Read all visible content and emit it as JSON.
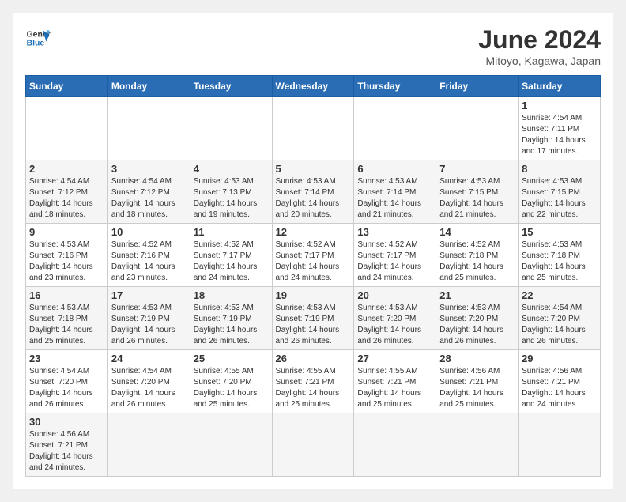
{
  "header": {
    "logo_general": "General",
    "logo_blue": "Blue",
    "month_title": "June 2024",
    "location": "Mitoyo, Kagawa, Japan"
  },
  "days_of_week": [
    "Sunday",
    "Monday",
    "Tuesday",
    "Wednesday",
    "Thursday",
    "Friday",
    "Saturday"
  ],
  "weeks": [
    [
      {
        "day": "",
        "info": ""
      },
      {
        "day": "",
        "info": ""
      },
      {
        "day": "",
        "info": ""
      },
      {
        "day": "",
        "info": ""
      },
      {
        "day": "",
        "info": ""
      },
      {
        "day": "",
        "info": ""
      },
      {
        "day": "1",
        "info": "Sunrise: 4:54 AM\nSunset: 7:11 PM\nDaylight: 14 hours\nand 17 minutes."
      }
    ],
    [
      {
        "day": "2",
        "info": "Sunrise: 4:54 AM\nSunset: 7:12 PM\nDaylight: 14 hours\nand 18 minutes."
      },
      {
        "day": "3",
        "info": "Sunrise: 4:54 AM\nSunset: 7:12 PM\nDaylight: 14 hours\nand 18 minutes."
      },
      {
        "day": "4",
        "info": "Sunrise: 4:53 AM\nSunset: 7:13 PM\nDaylight: 14 hours\nand 19 minutes."
      },
      {
        "day": "5",
        "info": "Sunrise: 4:53 AM\nSunset: 7:14 PM\nDaylight: 14 hours\nand 20 minutes."
      },
      {
        "day": "6",
        "info": "Sunrise: 4:53 AM\nSunset: 7:14 PM\nDaylight: 14 hours\nand 21 minutes."
      },
      {
        "day": "7",
        "info": "Sunrise: 4:53 AM\nSunset: 7:15 PM\nDaylight: 14 hours\nand 21 minutes."
      },
      {
        "day": "8",
        "info": "Sunrise: 4:53 AM\nSunset: 7:15 PM\nDaylight: 14 hours\nand 22 minutes."
      }
    ],
    [
      {
        "day": "9",
        "info": "Sunrise: 4:53 AM\nSunset: 7:16 PM\nDaylight: 14 hours\nand 23 minutes."
      },
      {
        "day": "10",
        "info": "Sunrise: 4:52 AM\nSunset: 7:16 PM\nDaylight: 14 hours\nand 23 minutes."
      },
      {
        "day": "11",
        "info": "Sunrise: 4:52 AM\nSunset: 7:17 PM\nDaylight: 14 hours\nand 24 minutes."
      },
      {
        "day": "12",
        "info": "Sunrise: 4:52 AM\nSunset: 7:17 PM\nDaylight: 14 hours\nand 24 minutes."
      },
      {
        "day": "13",
        "info": "Sunrise: 4:52 AM\nSunset: 7:17 PM\nDaylight: 14 hours\nand 24 minutes."
      },
      {
        "day": "14",
        "info": "Sunrise: 4:52 AM\nSunset: 7:18 PM\nDaylight: 14 hours\nand 25 minutes."
      },
      {
        "day": "15",
        "info": "Sunrise: 4:53 AM\nSunset: 7:18 PM\nDaylight: 14 hours\nand 25 minutes."
      }
    ],
    [
      {
        "day": "16",
        "info": "Sunrise: 4:53 AM\nSunset: 7:18 PM\nDaylight: 14 hours\nand 25 minutes."
      },
      {
        "day": "17",
        "info": "Sunrise: 4:53 AM\nSunset: 7:19 PM\nDaylight: 14 hours\nand 26 minutes."
      },
      {
        "day": "18",
        "info": "Sunrise: 4:53 AM\nSunset: 7:19 PM\nDaylight: 14 hours\nand 26 minutes."
      },
      {
        "day": "19",
        "info": "Sunrise: 4:53 AM\nSunset: 7:19 PM\nDaylight: 14 hours\nand 26 minutes."
      },
      {
        "day": "20",
        "info": "Sunrise: 4:53 AM\nSunset: 7:20 PM\nDaylight: 14 hours\nand 26 minutes."
      },
      {
        "day": "21",
        "info": "Sunrise: 4:53 AM\nSunset: 7:20 PM\nDaylight: 14 hours\nand 26 minutes."
      },
      {
        "day": "22",
        "info": "Sunrise: 4:54 AM\nSunset: 7:20 PM\nDaylight: 14 hours\nand 26 minutes."
      }
    ],
    [
      {
        "day": "23",
        "info": "Sunrise: 4:54 AM\nSunset: 7:20 PM\nDaylight: 14 hours\nand 26 minutes."
      },
      {
        "day": "24",
        "info": "Sunrise: 4:54 AM\nSunset: 7:20 PM\nDaylight: 14 hours\nand 26 minutes."
      },
      {
        "day": "25",
        "info": "Sunrise: 4:55 AM\nSunset: 7:20 PM\nDaylight: 14 hours\nand 25 minutes."
      },
      {
        "day": "26",
        "info": "Sunrise: 4:55 AM\nSunset: 7:21 PM\nDaylight: 14 hours\nand 25 minutes."
      },
      {
        "day": "27",
        "info": "Sunrise: 4:55 AM\nSunset: 7:21 PM\nDaylight: 14 hours\nand 25 minutes."
      },
      {
        "day": "28",
        "info": "Sunrise: 4:56 AM\nSunset: 7:21 PM\nDaylight: 14 hours\nand 25 minutes."
      },
      {
        "day": "29",
        "info": "Sunrise: 4:56 AM\nSunset: 7:21 PM\nDaylight: 14 hours\nand 24 minutes."
      }
    ],
    [
      {
        "day": "30",
        "info": "Sunrise: 4:56 AM\nSunset: 7:21 PM\nDaylight: 14 hours\nand 24 minutes."
      },
      {
        "day": "",
        "info": ""
      },
      {
        "day": "",
        "info": ""
      },
      {
        "day": "",
        "info": ""
      },
      {
        "day": "",
        "info": ""
      },
      {
        "day": "",
        "info": ""
      },
      {
        "day": "",
        "info": ""
      }
    ]
  ]
}
